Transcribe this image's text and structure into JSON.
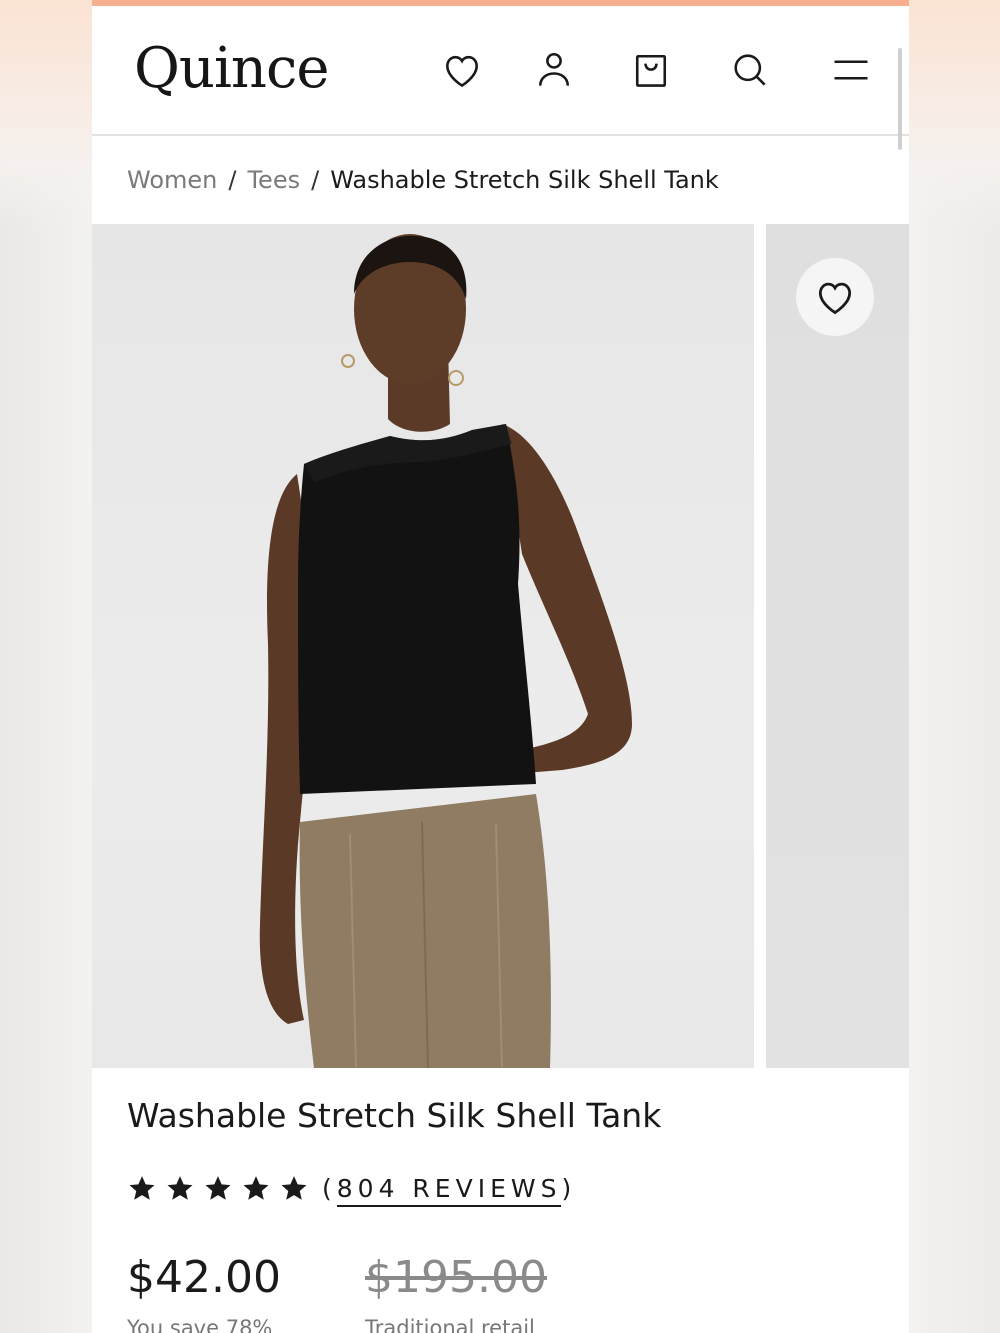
{
  "brand": {
    "logo_text": "Quince",
    "accent_color": "#f7b08f"
  },
  "header": {
    "icons": [
      "heart-icon",
      "account-icon",
      "cart-icon",
      "search-icon",
      "menu-icon"
    ]
  },
  "breadcrumb": {
    "items": [
      "Women",
      "Tees",
      "Washable Stretch Silk Shell Tank"
    ],
    "separator": "/"
  },
  "gallery": {
    "main_image": "Model wearing a black sleeveless silk shell tank with taupe trousers",
    "wishlist_icon": "heart-icon"
  },
  "product": {
    "title": "Washable Stretch Silk Shell Tank",
    "rating": 5,
    "rating_max": 5,
    "reviews_label": "(804 REVIEWS)",
    "reviews_link_text": "804 REVIEWS",
    "price": "$42.00",
    "original_price": "$195.00",
    "savings": "You save 78%",
    "original_price_label": "Traditional retail"
  }
}
